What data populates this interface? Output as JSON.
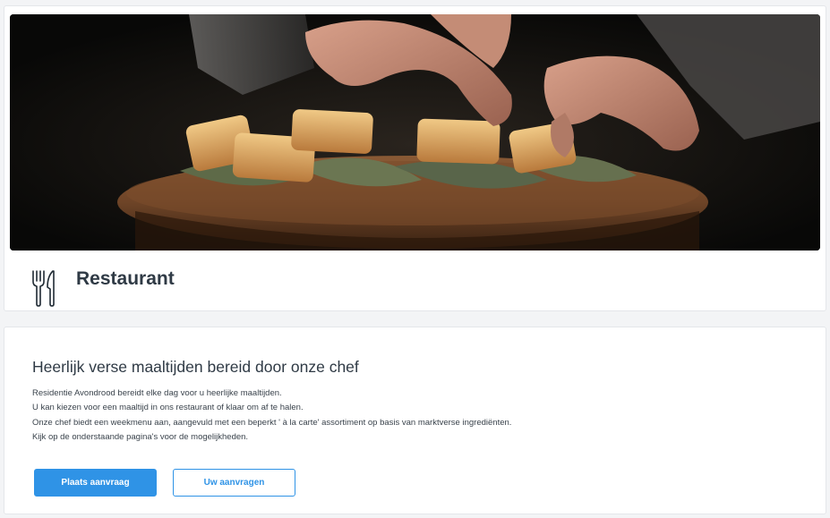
{
  "header": {
    "hero_image": "restaurant-chef-plating-food-photo",
    "icon": "cutlery-icon",
    "title": "Restaurant"
  },
  "content": {
    "heading": "Heerlijk verse maaltijden bereid door onze chef",
    "paragraph_lines": [
      "Residentie Avondrood bereidt elke dag voor u heerlijke maaltijden.",
      "U kan kiezen voor een maaltijd in ons restaurant of klaar om af te halen.",
      "Onze chef biedt een weekmenu aan, aangevuld met een beperkt ' à la carte' assortiment op basis van marktverse ingrediënten.",
      "Kijk op de onderstaande pagina's voor de mogelijkheden."
    ]
  },
  "actions": {
    "primary_label": "Plaats aanvraag",
    "secondary_label": "Uw aanvragen"
  },
  "colors": {
    "accent": "#2f93e6",
    "title_text": "#2f3a45",
    "page_background": "#f3f4f6"
  }
}
